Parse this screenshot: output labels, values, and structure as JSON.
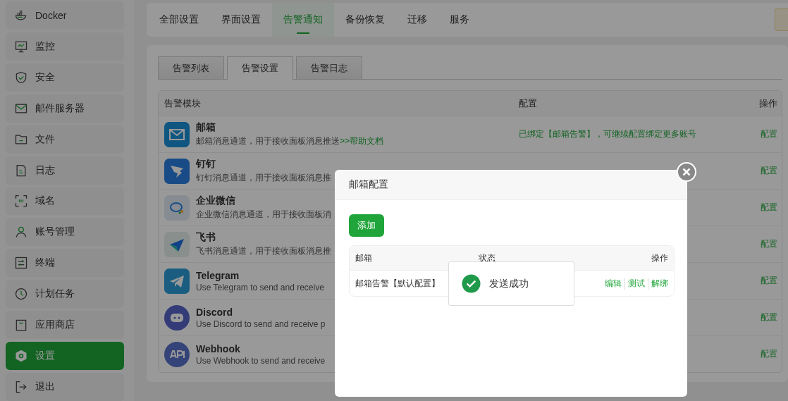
{
  "sidebar": {
    "items": [
      {
        "label": "Docker",
        "selected": false
      },
      {
        "label": "监控",
        "selected": false
      },
      {
        "label": "安全",
        "selected": false
      },
      {
        "label": "邮件服务器",
        "selected": false
      },
      {
        "label": "文件",
        "selected": false
      },
      {
        "label": "日志",
        "selected": false
      },
      {
        "label": "域名",
        "selected": false
      },
      {
        "label": "账号管理",
        "selected": false
      },
      {
        "label": "终端",
        "selected": false
      },
      {
        "label": "计划任务",
        "selected": false
      },
      {
        "label": "应用商店",
        "selected": false
      },
      {
        "label": "设置",
        "selected": true
      },
      {
        "label": "退出",
        "selected": false
      }
    ]
  },
  "settings_tabs": [
    {
      "label": "全部设置",
      "selected": false
    },
    {
      "label": "界面设置",
      "selected": false
    },
    {
      "label": "告警通知",
      "selected": true
    },
    {
      "label": "备份恢复",
      "selected": false
    },
    {
      "label": "迁移",
      "selected": false
    },
    {
      "label": "服务",
      "selected": false
    }
  ],
  "alert_tabs": [
    {
      "label": "告警列表",
      "selected": false
    },
    {
      "label": "告警设置",
      "selected": true
    },
    {
      "label": "告警日志",
      "selected": false
    }
  ],
  "table": {
    "columns": [
      "告警模块",
      "配置",
      "操作"
    ],
    "rows": [
      {
        "kind": "mail",
        "name": "邮箱",
        "description": "邮箱消息通道，用于接收面板消息推送",
        "link": ">>帮助文档",
        "config": "已绑定【邮箱告警】，可继续配置绑定更多账号",
        "action": "配置"
      },
      {
        "kind": "dingtalk",
        "name": "钉钉",
        "description": "钉钉消息通道，用于接收面板消息推",
        "action": "配置"
      },
      {
        "kind": "wecom",
        "name": "企业微信",
        "description": "企业微信消息通道，用于接收面板消",
        "action": "配置"
      },
      {
        "kind": "feishu",
        "name": "飞书",
        "description": "飞书消息通道，用于接收面板消息推",
        "action": "配置"
      },
      {
        "kind": "telegram",
        "name": "Telegram",
        "description": "Use Telegram to send and receive",
        "action": "配置"
      },
      {
        "kind": "discord",
        "name": "Discord",
        "description": "Use Discord to send and receive p",
        "action": "配置"
      },
      {
        "kind": "api",
        "name": "Webhook",
        "description": "Use Webhook to send and receive",
        "action": "配置"
      }
    ]
  },
  "dialog": {
    "title": "邮箱配置",
    "add_button": "添加",
    "columns": [
      "邮箱",
      "状态",
      "操作"
    ],
    "rows": [
      {
        "name": "邮箱告警【默认配置】",
        "actions": [
          "编辑",
          "测试",
          "解绑"
        ]
      }
    ]
  },
  "toast": {
    "message": "发送成功"
  }
}
